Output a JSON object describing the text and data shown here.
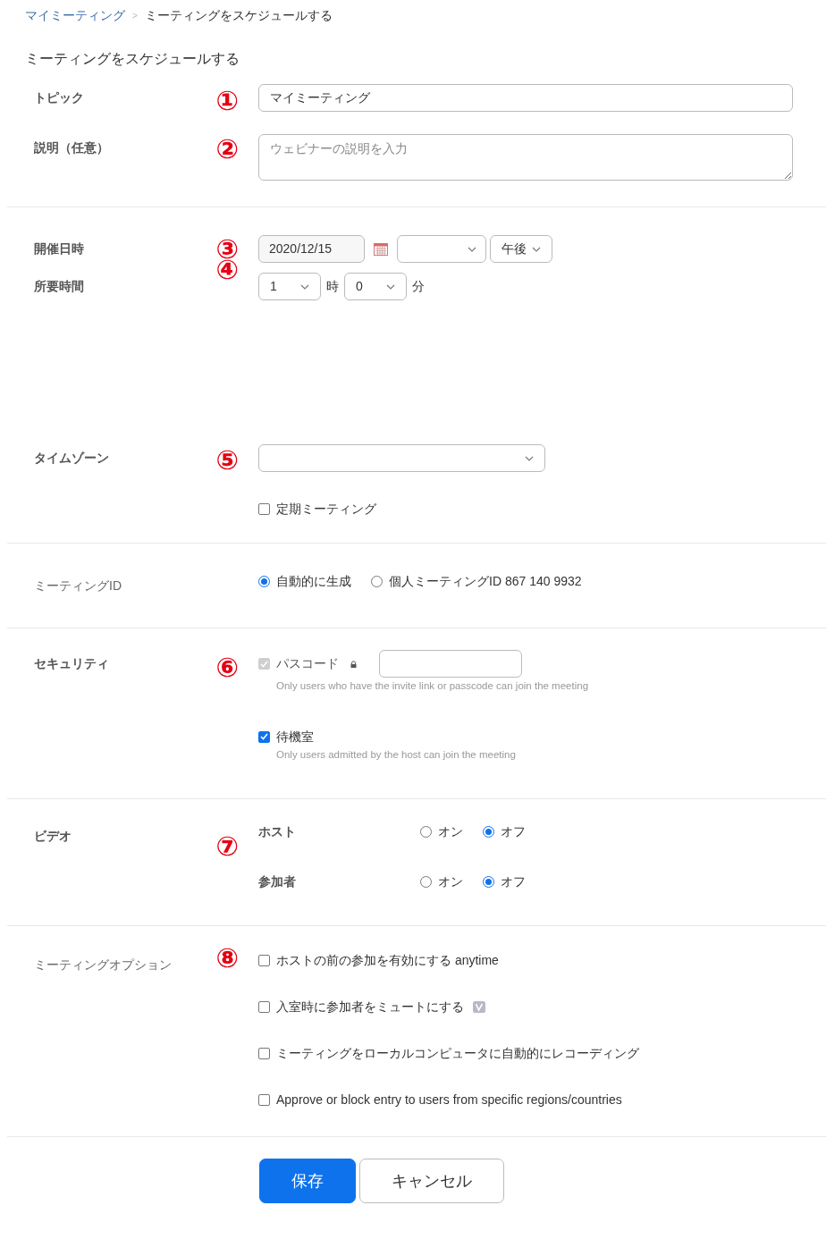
{
  "breadcrumb": {
    "parent": "マイミーティング",
    "separator": ">",
    "current": "ミーティングをスケジュールする"
  },
  "title": "ミーティングをスケジュールする",
  "sections": [
    {
      "kind": "topic",
      "label": "トピック",
      "label_bold": true,
      "marker": "①",
      "value": "マイミーティング"
    },
    {
      "kind": "description",
      "label": "説明（任意）",
      "label_bold": true,
      "marker": "②",
      "placeholder": "ウェビナーの説明を入力",
      "divider_after": true
    },
    {
      "kind": "when",
      "label": "開催日時",
      "label_bold": true,
      "marker": "③",
      "date": "2020/12/15",
      "ampm": "午後"
    },
    {
      "kind": "duration",
      "label": "所要時間",
      "label_bold": true,
      "marker": "④",
      "hours": "1",
      "hours_unit": "時",
      "minutes": "0",
      "minutes_unit": "分"
    },
    {
      "kind": "timezone",
      "label": "タイムゾーン",
      "label_bold": true,
      "marker": "⑤",
      "recurring": {
        "label": "定期ミーティング",
        "checked": false
      },
      "divider_after": true
    },
    {
      "kind": "meeting_id",
      "label": "ミーティングID",
      "label_bold": false,
      "options": [
        {
          "label": "自動的に生成",
          "selected": true
        },
        {
          "label": "個人ミーティングID 867 140 9932",
          "selected": false
        }
      ],
      "divider_after": true
    },
    {
      "kind": "security",
      "label": "セキュリティ",
      "label_bold": true,
      "marker": "⑥",
      "options": [
        {
          "kind": "passcode",
          "label": "パスコード",
          "checked": true,
          "disabled": true,
          "hint": "Only users who have the invite link or passcode can join the meeting"
        },
        {
          "kind": "plain",
          "label": "待機室",
          "checked": true,
          "disabled": false,
          "hint": "Only users admitted by the host can join the meeting"
        }
      ],
      "divider_after": true
    },
    {
      "kind": "video",
      "label": "ビデオ",
      "label_bold": true,
      "marker": "⑦",
      "rows": [
        {
          "label": "ホスト",
          "options": [
            {
              "label": "オン",
              "selected": false
            },
            {
              "label": "オフ",
              "selected": true
            }
          ]
        },
        {
          "label": "参加者",
          "options": [
            {
              "label": "オン",
              "selected": false
            },
            {
              "label": "オフ",
              "selected": true
            }
          ]
        }
      ],
      "divider_after": true
    },
    {
      "kind": "options",
      "label": "ミーティングオプション",
      "label_bold": false,
      "marker": "⑧",
      "options": [
        {
          "label": "ホストの前の参加を有効にする anytime",
          "checked": false,
          "badge": false
        },
        {
          "label": "入室時に参加者をミュートにする",
          "checked": false,
          "badge": true
        },
        {
          "label": "ミーティングをローカルコンピュータに自動的にレコーディング",
          "checked": false,
          "badge": false
        },
        {
          "label": "Approve or block entry to users from specific regions/countries",
          "checked": false,
          "badge": false
        }
      ],
      "divider_after": true
    }
  ],
  "buttons": [
    {
      "label": "保存",
      "kind": "primary"
    },
    {
      "label": "キャンセル",
      "kind": "secondary"
    }
  ]
}
